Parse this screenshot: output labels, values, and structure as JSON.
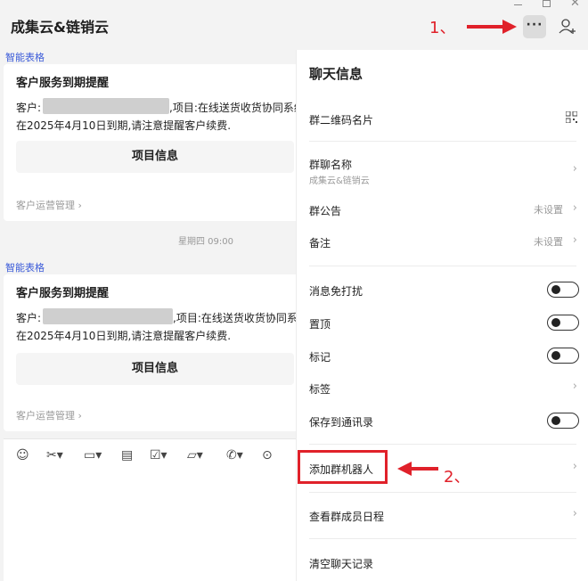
{
  "header": {
    "title": "成集云&链销云",
    "more_label": "···",
    "annotation_1": "1、",
    "annotation_2": "2、"
  },
  "chat": {
    "messages": [
      {
        "source": "智能表格",
        "title": "客户服务到期提醒",
        "line1_prefix": "客户:",
        "line1_suffix": ",项目:在线送货收货协同系统",
        "line2": "在2025年4月10日到期,请注意提醒客户续费.",
        "button": "项目信息",
        "footer": "客户运营管理 ›"
      },
      {
        "source": "智能表格",
        "title": "客户服务到期提醒",
        "line1_prefix": "客户:",
        "line1_suffix": ",项目:在线送货收货协同系统",
        "line2": "在2025年4月10日到期,请注意提醒客户续费.",
        "button": "项目信息",
        "footer": "客户运营管理 ›"
      }
    ],
    "date_separator": "星期四 09:00"
  },
  "panel": {
    "title": "聊天信息",
    "qr_label": "群二维码名片",
    "group_name_label": "群聊名称",
    "group_name_value": "成集云&链销云",
    "announcement_label": "群公告",
    "announcement_value": "未设置",
    "remark_label": "备注",
    "remark_value": "未设置",
    "mute_label": "消息免打扰",
    "pin_label": "置顶",
    "mark_label": "标记",
    "tag_label": "标签",
    "save_label": "保存到通讯录",
    "add_bot_label": "添加群机器人",
    "schedule_label": "查看群成员日程",
    "clear_label": "清空聊天记录"
  },
  "colors": {
    "accent_red": "#e0212a",
    "link_blue": "#3b5bd9"
  }
}
